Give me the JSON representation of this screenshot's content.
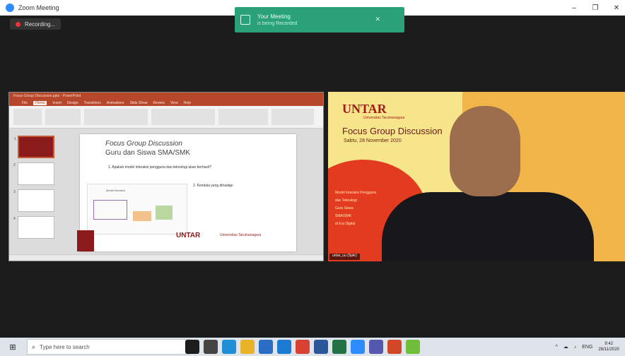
{
  "window": {
    "title": "Zoom Meeting",
    "controls": [
      "–",
      "❐",
      "✕"
    ]
  },
  "recording": {
    "label": "Recording..."
  },
  "toast": {
    "line1": "Your Meeting",
    "line2": "is being Recorded",
    "close": "✕"
  },
  "ppt": {
    "title_text": [
      "Focus Group Discussion.pptx - PowerPoint"
    ],
    "tabs": [
      "File",
      "Home",
      "Insert",
      "Design",
      "Transitions",
      "Animations",
      "Slide Show",
      "Review",
      "View",
      "Help"
    ],
    "thumb_numbers": [
      "1",
      "2",
      "3",
      "4"
    ],
    "slide": {
      "title_line1": "Focus Group Discussion",
      "title_line2": "Guru dan Siswa SMA/SMK",
      "point1": "1. Apakah model interaksi pengguna dan teknologi akan berhasil?",
      "point2": "2. Kendala yang dihadapi",
      "diagram_title": "Model Interaksi",
      "logo": "UNTAR",
      "logo_sub": "Universitas Tarumanagara"
    }
  },
  "video": {
    "logo": "UNTAR",
    "logo_sub": "Universitas Tarumanagara",
    "title": "Focus Group Discussion",
    "date": "Sabtu, 28 November 2020",
    "lines": [
      "Model Interaksi Pengguna",
      "dan Teknologi",
      "Guru Siswa",
      "SMA/SMK",
      "di Era Digital"
    ],
    "name_tag": "untar_uu (Spkr)"
  },
  "taskbar": {
    "start_icon": "windows-icon",
    "search_placeholder": "Type here to search",
    "apps": [
      {
        "name": "cortana-icon",
        "color": "#1d1d1d"
      },
      {
        "name": "task-view-icon",
        "color": "#444"
      },
      {
        "name": "edge-icon",
        "color": "#1f8fd8"
      },
      {
        "name": "file-explorer-icon",
        "color": "#e8b229"
      },
      {
        "name": "store-icon",
        "color": "#2b6cc4"
      },
      {
        "name": "mail-icon",
        "color": "#1b7ad1"
      },
      {
        "name": "chrome-icon",
        "color": "#d94133"
      },
      {
        "name": "word-icon",
        "color": "#2b579a"
      },
      {
        "name": "excel-icon",
        "color": "#217346"
      },
      {
        "name": "zoom-icon",
        "color": "#2d8cff"
      },
      {
        "name": "teams-icon",
        "color": "#5558af"
      },
      {
        "name": "powerpoint-icon",
        "color": "#d24726"
      },
      {
        "name": "green-app-icon",
        "color": "#6fbf3c"
      }
    ],
    "tray": [
      "^",
      "☁",
      "♪",
      "ENG"
    ],
    "time": "9:42",
    "date": "28/11/2020"
  }
}
